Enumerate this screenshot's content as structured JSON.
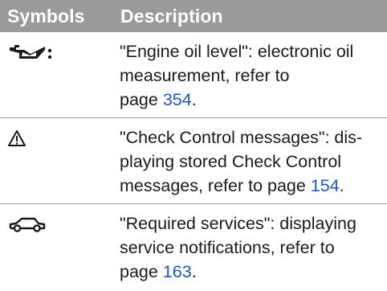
{
  "table": {
    "header": {
      "symbols": "Symbols",
      "description": "Description"
    },
    "rows": [
      {
        "icon": "engine-oil-icon",
        "text": "\"Engine oil level\": electronic oil measurement, refer to page ",
        "line1": "\"Engine oil level\": electronic oil",
        "line2": "measurement, refer to",
        "line3_prefix": "page ",
        "page": "354",
        "suffix": "."
      },
      {
        "icon": "warning-triangle-icon",
        "line1": "\"Check Control messages\": dis-",
        "line2": "playing stored Check Control",
        "line3_prefix": "messages, refer to page ",
        "page": "154",
        "suffix": "."
      },
      {
        "icon": "car-service-icon",
        "line1": "\"Required services\": displaying",
        "line2": "service notifications, refer to",
        "line3_prefix": "page ",
        "page": "163",
        "suffix": "."
      }
    ]
  },
  "colors": {
    "header_bg": "#9a9a9a",
    "link": "#1a56c9"
  }
}
